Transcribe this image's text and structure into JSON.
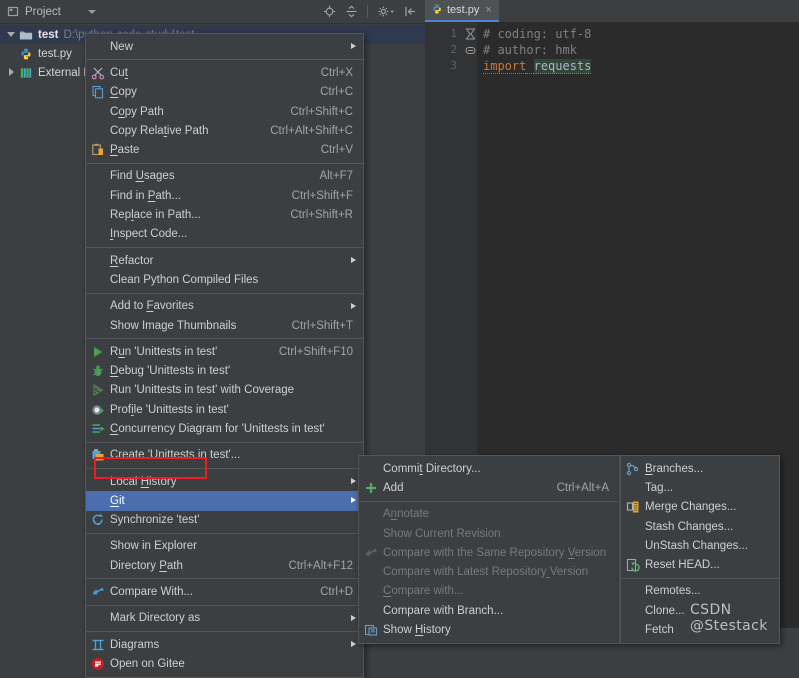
{
  "project_panel": {
    "title": "Project",
    "toolbar_icons": [
      "locate-target-icon",
      "collapse-all-icon",
      "settings-gear-icon",
      "hide-panel-icon"
    ],
    "tree": [
      {
        "name": "test",
        "path": "D:\\python-code-study\\test",
        "icon": "folder-icon",
        "expanded": true,
        "selected": true,
        "depth": 0
      },
      {
        "name": "test.py",
        "path": "",
        "icon": "python-file-icon",
        "expanded": false,
        "selected": false,
        "depth": 1
      },
      {
        "name": "External Libraries",
        "path": "",
        "icon": "libraries-icon",
        "expanded": false,
        "selected": false,
        "depth": 0
      }
    ]
  },
  "editor": {
    "tab": {
      "label": "test.py",
      "icon": "python-file-icon",
      "close": "×"
    },
    "lines": [
      {
        "num": "1",
        "text": "# coding: utf-8",
        "type": "comment",
        "fold": "fold-collapsed"
      },
      {
        "num": "2",
        "text": "# author: hmk",
        "type": "comment",
        "fold": "fold-minus"
      },
      {
        "num": "3",
        "text": "import requests",
        "type": "import",
        "fold": ""
      }
    ],
    "line3_keyword": "import",
    "line3_module": "requests"
  },
  "context_menu": {
    "items": [
      {
        "label": "New",
        "key": "",
        "icon": "",
        "submenu": true,
        "disabled": false
      },
      {
        "sep": true
      },
      {
        "label": "Cut",
        "key": "Ctrl+X",
        "icon": "scissors-icon",
        "submenu": false,
        "disabled": false,
        "mnemonic": 2
      },
      {
        "label": "Copy",
        "key": "Ctrl+C",
        "icon": "copy-icon",
        "submenu": false,
        "disabled": false,
        "mnemonic": 0
      },
      {
        "label": "Copy Path",
        "key": "Ctrl+Shift+C",
        "icon": "",
        "submenu": false,
        "disabled": false,
        "mnemonic": 1
      },
      {
        "label": "Copy Relative Path",
        "key": "Ctrl+Alt+Shift+C",
        "icon": "",
        "submenu": false,
        "disabled": false,
        "mnemonic": 9
      },
      {
        "label": "Paste",
        "key": "Ctrl+V",
        "icon": "paste-icon",
        "submenu": false,
        "disabled": false,
        "mnemonic": 0
      },
      {
        "sep": true
      },
      {
        "label": "Find Usages",
        "key": "Alt+F7",
        "icon": "",
        "submenu": false,
        "disabled": false,
        "mnemonic": 5
      },
      {
        "label": "Find in Path...",
        "key": "Ctrl+Shift+F",
        "icon": "",
        "submenu": false,
        "disabled": false,
        "mnemonic": 8
      },
      {
        "label": "Replace in Path...",
        "key": "Ctrl+Shift+R",
        "icon": "",
        "submenu": false,
        "disabled": false,
        "mnemonic": 3
      },
      {
        "label": "Inspect Code...",
        "key": "",
        "icon": "",
        "submenu": false,
        "disabled": false,
        "mnemonic": 0
      },
      {
        "sep": true
      },
      {
        "label": "Refactor",
        "key": "",
        "icon": "",
        "submenu": true,
        "disabled": false,
        "mnemonic": 0
      },
      {
        "label": "Clean Python Compiled Files",
        "key": "",
        "icon": "",
        "submenu": false,
        "disabled": false
      },
      {
        "sep": true
      },
      {
        "label": "Add to Favorites",
        "key": "",
        "icon": "",
        "submenu": true,
        "disabled": false,
        "mnemonic": 7
      },
      {
        "label": "Show Image Thumbnails",
        "key": "Ctrl+Shift+T",
        "icon": "",
        "submenu": false,
        "disabled": false
      },
      {
        "sep": true
      },
      {
        "label": "Run 'Unittests in test'",
        "key": "Ctrl+Shift+F10",
        "icon": "run-green-play-icon",
        "submenu": false,
        "disabled": false,
        "mnemonic": 1
      },
      {
        "label": "Debug 'Unittests in test'",
        "key": "",
        "icon": "debug-bug-icon",
        "submenu": false,
        "disabled": false,
        "mnemonic": 0
      },
      {
        "label": "Run 'Unittests in test' with Coverage",
        "key": "",
        "icon": "coverage-icon",
        "submenu": false,
        "disabled": false
      },
      {
        "label": "Profile 'Unittests in test'",
        "key": "",
        "icon": "profile-icon",
        "submenu": false,
        "disabled": false,
        "mnemonic": 4
      },
      {
        "label": "Concurrency Diagram for  'Unittests in test'",
        "key": "",
        "icon": "concurrency-diagram-icon",
        "submenu": false,
        "disabled": false,
        "mnemonic": 0
      },
      {
        "sep": true
      },
      {
        "label": "Create 'Unittests in test'...",
        "key": "",
        "icon": "create-config-icon",
        "submenu": false,
        "disabled": false
      },
      {
        "sep": true
      },
      {
        "label": "Local History",
        "key": "",
        "icon": "",
        "submenu": true,
        "disabled": false,
        "mnemonic": 6
      },
      {
        "label": "Git",
        "key": "",
        "icon": "",
        "submenu": true,
        "disabled": false,
        "highlighted": true,
        "mnemonic": 0
      },
      {
        "label": "Synchronize 'test'",
        "key": "",
        "icon": "synchronize-icon",
        "submenu": false,
        "disabled": false
      },
      {
        "sep": true
      },
      {
        "label": "Show in Explorer",
        "key": "",
        "icon": "",
        "submenu": false,
        "disabled": false
      },
      {
        "label": "Directory Path",
        "key": "Ctrl+Alt+F12",
        "icon": "",
        "submenu": false,
        "disabled": false,
        "mnemonic": 10
      },
      {
        "sep": true
      },
      {
        "label": "Compare With...",
        "key": "Ctrl+D",
        "icon": "compare-icon",
        "submenu": false,
        "disabled": false
      },
      {
        "sep": true
      },
      {
        "label": "Mark Directory as",
        "key": "",
        "icon": "",
        "submenu": true,
        "disabled": false
      },
      {
        "sep": true
      },
      {
        "label": "Diagrams",
        "key": "",
        "icon": "diagrams-icon",
        "submenu": true,
        "disabled": false
      },
      {
        "label": "Open on Gitee",
        "key": "",
        "icon": "gitee-icon",
        "submenu": false,
        "disabled": false
      }
    ]
  },
  "git_submenu": {
    "items": [
      {
        "label": "Commit Directory...",
        "key": "",
        "icon": "",
        "submenu": false,
        "disabled": false,
        "mnemonic": 5
      },
      {
        "label": "Add",
        "key": "Ctrl+Alt+A",
        "icon": "plus-green-icon",
        "submenu": false,
        "disabled": false
      },
      {
        "sep": true
      },
      {
        "label": "Annotate",
        "key": "",
        "icon": "",
        "submenu": false,
        "disabled": true,
        "mnemonic": 1
      },
      {
        "label": "Show Current Revision",
        "key": "",
        "icon": "",
        "submenu": false,
        "disabled": true
      },
      {
        "label": "Compare with the Same Repository Version",
        "key": "",
        "icon": "compare-icon-dim",
        "submenu": false,
        "disabled": true,
        "mnemonic": 33
      },
      {
        "label": "Compare with Latest Repository Version",
        "key": "",
        "icon": "",
        "submenu": false,
        "disabled": true,
        "mnemonic": 30
      },
      {
        "label": "Compare with...",
        "key": "",
        "icon": "",
        "submenu": false,
        "disabled": true,
        "mnemonic": 0
      },
      {
        "label": "Compare with Branch...",
        "key": "",
        "icon": "",
        "submenu": false,
        "disabled": false
      },
      {
        "label": "Show History",
        "key": "",
        "icon": "show-history-icon",
        "submenu": false,
        "disabled": false,
        "mnemonic": 5
      }
    ]
  },
  "git_submenu2": {
    "items": [
      {
        "label": "Branches...",
        "key": "",
        "icon": "branches-icon",
        "submenu": false,
        "disabled": false,
        "mnemonic": 0
      },
      {
        "label": "Tag...",
        "key": "",
        "icon": "",
        "submenu": false,
        "disabled": false
      },
      {
        "label": "Merge Changes...",
        "key": "",
        "icon": "merge-icon",
        "submenu": false,
        "disabled": false
      },
      {
        "label": "Stash Changes...",
        "key": "",
        "icon": "",
        "submenu": false,
        "disabled": false
      },
      {
        "label": "UnStash Changes...",
        "key": "",
        "icon": "",
        "submenu": false,
        "disabled": false
      },
      {
        "label": "Reset HEAD...",
        "key": "",
        "icon": "reset-head-icon",
        "submenu": false,
        "disabled": false
      },
      {
        "sep": true
      },
      {
        "label": "Remotes...",
        "key": "",
        "icon": "",
        "submenu": false,
        "disabled": false
      },
      {
        "label": "Clone...",
        "key": "",
        "icon": "",
        "submenu": false,
        "disabled": false
      },
      {
        "label": "Fetch",
        "key": "",
        "icon": "",
        "submenu": false,
        "disabled": false
      }
    ]
  },
  "watermark": "CSDN @Stestack",
  "colors": {
    "background": "#3c3f41",
    "editor_background": "#2b2b2b",
    "menu_background": "#3c3f41",
    "highlight_blue": "#4b6eaf",
    "annotation_red": "#ee1d24",
    "tree_selection": "#2f3a4f",
    "tab_underline": "#4a88c7",
    "disabled_text": "#777b7e"
  }
}
